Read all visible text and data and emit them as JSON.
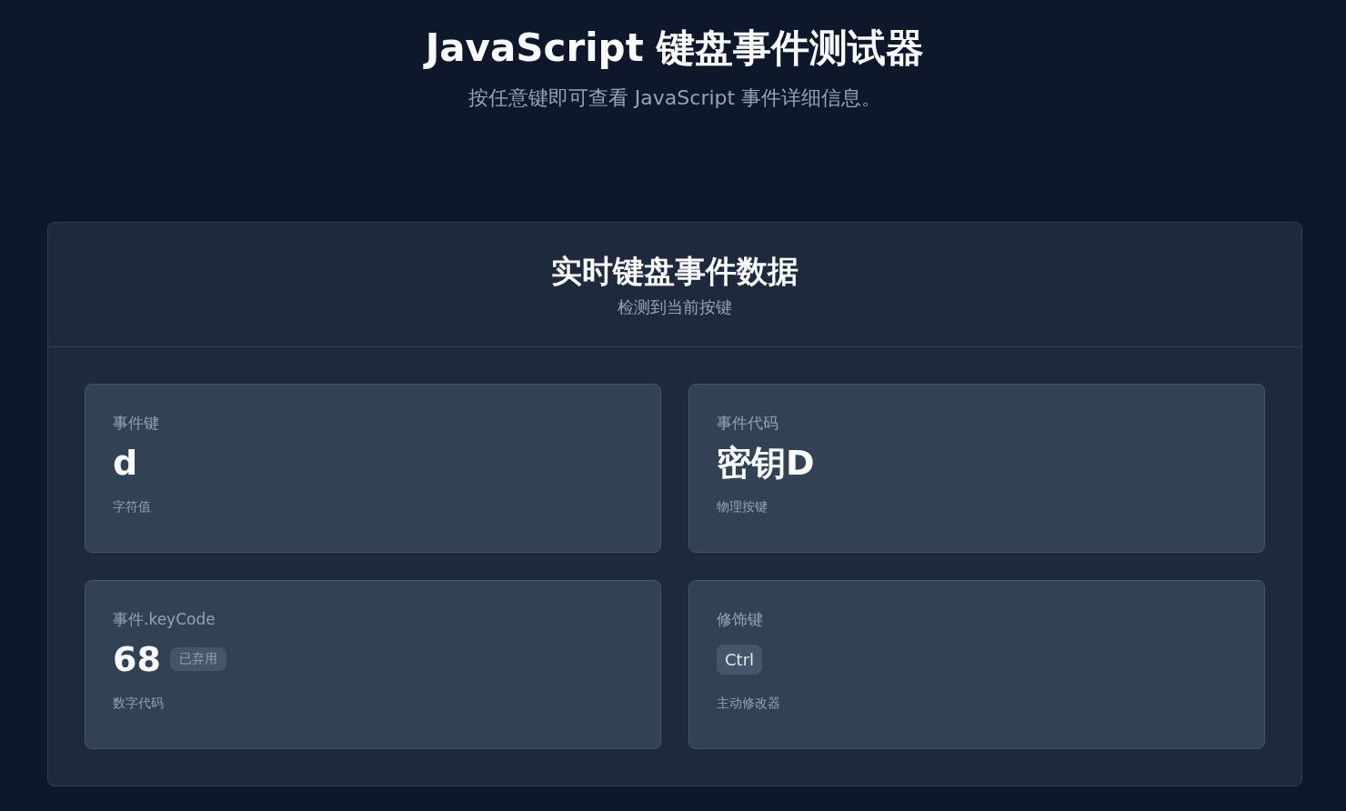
{
  "header": {
    "title": "JavaScript 键盘事件测试器",
    "subtitle": "按任意键即可查看 JavaScript 事件详细信息。"
  },
  "panel": {
    "title": "实时键盘事件数据",
    "subtitle": "检测到当前按键"
  },
  "cards": [
    {
      "kind": "value",
      "label": "事件键",
      "value": "d",
      "note": "字符值"
    },
    {
      "kind": "value",
      "label": "事件代码",
      "value": "密钥D",
      "note": "物理按键"
    },
    {
      "kind": "value_badge",
      "label": "事件.keyCode",
      "value": "68",
      "badge": "已弃用",
      "note": "数字代码"
    },
    {
      "kind": "modifiers",
      "label": "修饰键",
      "keys": [
        "Ctrl"
      ],
      "note": "主动修改器"
    }
  ]
}
